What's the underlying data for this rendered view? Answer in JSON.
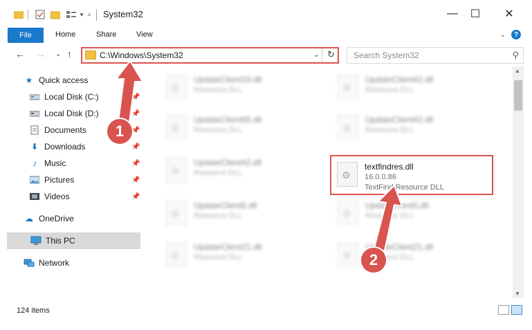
{
  "window": {
    "title": "System32",
    "minimize": "—",
    "maximize": "☐",
    "close": "✕"
  },
  "ribbon": {
    "tabs": [
      "File",
      "Home",
      "Share",
      "View"
    ]
  },
  "address": {
    "path": "C:\\Windows\\System32",
    "search_placeholder": "Search System32"
  },
  "sidebar": {
    "items": [
      {
        "label": "Quick access",
        "icon": "star-icon"
      },
      {
        "label": "Local Disk (C:)",
        "icon": "drive-icon"
      },
      {
        "label": "Local Disk (D:)",
        "icon": "drive-icon"
      },
      {
        "label": "Documents",
        "icon": "documents-icon"
      },
      {
        "label": "Downloads",
        "icon": "download-icon"
      },
      {
        "label": "Music",
        "icon": "music-icon"
      },
      {
        "label": "Pictures",
        "icon": "pictures-icon"
      },
      {
        "label": "Videos",
        "icon": "videos-icon"
      },
      {
        "label": "OneDrive",
        "icon": "cloud-icon"
      },
      {
        "label": "This PC",
        "icon": "computer-icon"
      },
      {
        "label": "Network",
        "icon": "network-icon"
      }
    ]
  },
  "files": {
    "left": [
      {
        "name": "UpdateClient19.dll",
        "type": "Resource DLL"
      },
      {
        "name": "UpdateClient65.dll",
        "type": "Resource DLL"
      },
      {
        "name": "UpdateClient42.dll",
        "type": "Resource DLL"
      },
      {
        "name": "UpdateClient5.dll",
        "type": "Resource DLL"
      },
      {
        "name": "UpdateClient21.dll",
        "type": "Resource DLL"
      }
    ],
    "right": [
      {
        "name": "UpdateClient42.dll",
        "type": "Resource DLL"
      },
      {
        "name": "UpdateClient42.dll",
        "type": "Resource DLL"
      },
      {
        "name": "UpdateClient5.dll",
        "type": "Resource DLL"
      },
      {
        "name": "UpdateClient21.dll",
        "type": "Resource DLL"
      }
    ],
    "highlighted": {
      "name": "textfindres.dll",
      "version": "16.0.0.86",
      "type": "TextFind Resource DLL"
    }
  },
  "status": {
    "items_count": "124 items"
  },
  "annotations": {
    "badge_1": "1",
    "badge_2": "2",
    "color": "#d9534f"
  }
}
